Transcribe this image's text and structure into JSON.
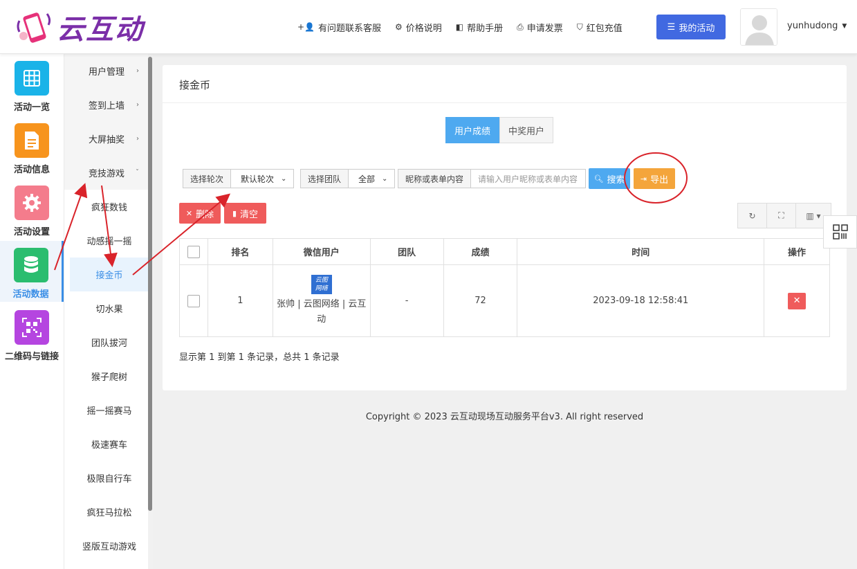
{
  "header": {
    "brand_name": "云互动",
    "links": [
      {
        "label": "有问题联系客服",
        "icon": "add-user-icon"
      },
      {
        "label": "价格说明",
        "icon": "gear-icon"
      },
      {
        "label": "帮助手册",
        "icon": "book-icon"
      },
      {
        "label": "申请发票",
        "icon": "printer-icon"
      },
      {
        "label": "红包充值",
        "icon": "shield-check-icon"
      }
    ],
    "my_activity": "我的活动",
    "username": "yunhudong"
  },
  "rail": {
    "items": [
      {
        "label": "活动一览",
        "icon": "grid-icon",
        "color": "#1ab3e8"
      },
      {
        "label": "活动信息",
        "icon": "document-icon",
        "color": "#f7941d"
      },
      {
        "label": "活动设置",
        "icon": "gear-icon",
        "color": "#f47c8c"
      },
      {
        "label": "活动数据",
        "icon": "database-icon",
        "color": "#2bbd6f"
      },
      {
        "label": "二维码与链接",
        "icon": "qrcode-icon",
        "color": "#b545e0"
      }
    ],
    "active_index": 3
  },
  "submenu": {
    "groups": [
      "用户管理",
      "签到上墙",
      "大屏抽奖",
      "竞技游戏"
    ],
    "items": [
      "疯狂数钱",
      "动感摇一摇",
      "接金币",
      "切水果",
      "团队拔河",
      "猴子爬树",
      "摇一摇赛马",
      "极速赛车",
      "极限自行车",
      "疯狂马拉松",
      "竖版互动游戏"
    ],
    "active_item": "接金币"
  },
  "panel": {
    "title": "接金币",
    "tabs": [
      "用户成绩",
      "中奖用户"
    ],
    "filters": {
      "round_label": "选择轮次",
      "round_value": "默认轮次",
      "team_label": "选择团队",
      "team_value": "全部",
      "keyword_label": "昵称或表单内容",
      "keyword_placeholder": "请输入用户昵称或表单内容"
    },
    "buttons": {
      "search": "搜索",
      "export": "导出",
      "delete": "删除",
      "clear": "清空"
    },
    "table": {
      "columns": [
        "排名",
        "微信用户",
        "团队",
        "成绩",
        "时间",
        "操作"
      ],
      "rows": [
        {
          "rank": "1",
          "avatar_text_1": "云图",
          "avatar_text_2": "网络",
          "user": "张帅 | 云图网络 | 云互动",
          "team": "-",
          "score": "72",
          "time": "2023-09-18 12:58:41"
        }
      ]
    },
    "records": "显示第 1 到第 1 条记录，总共 1 条记录"
  },
  "footer": {
    "copyright": "Copyright © 2023 云互动现场互动服务平台v3. All right reserved"
  },
  "colors": {
    "primary": "#4169e1",
    "info": "#4ea9f0",
    "warning": "#f4a53b",
    "danger": "#ef5b5b",
    "annotation": "#d9232a"
  }
}
